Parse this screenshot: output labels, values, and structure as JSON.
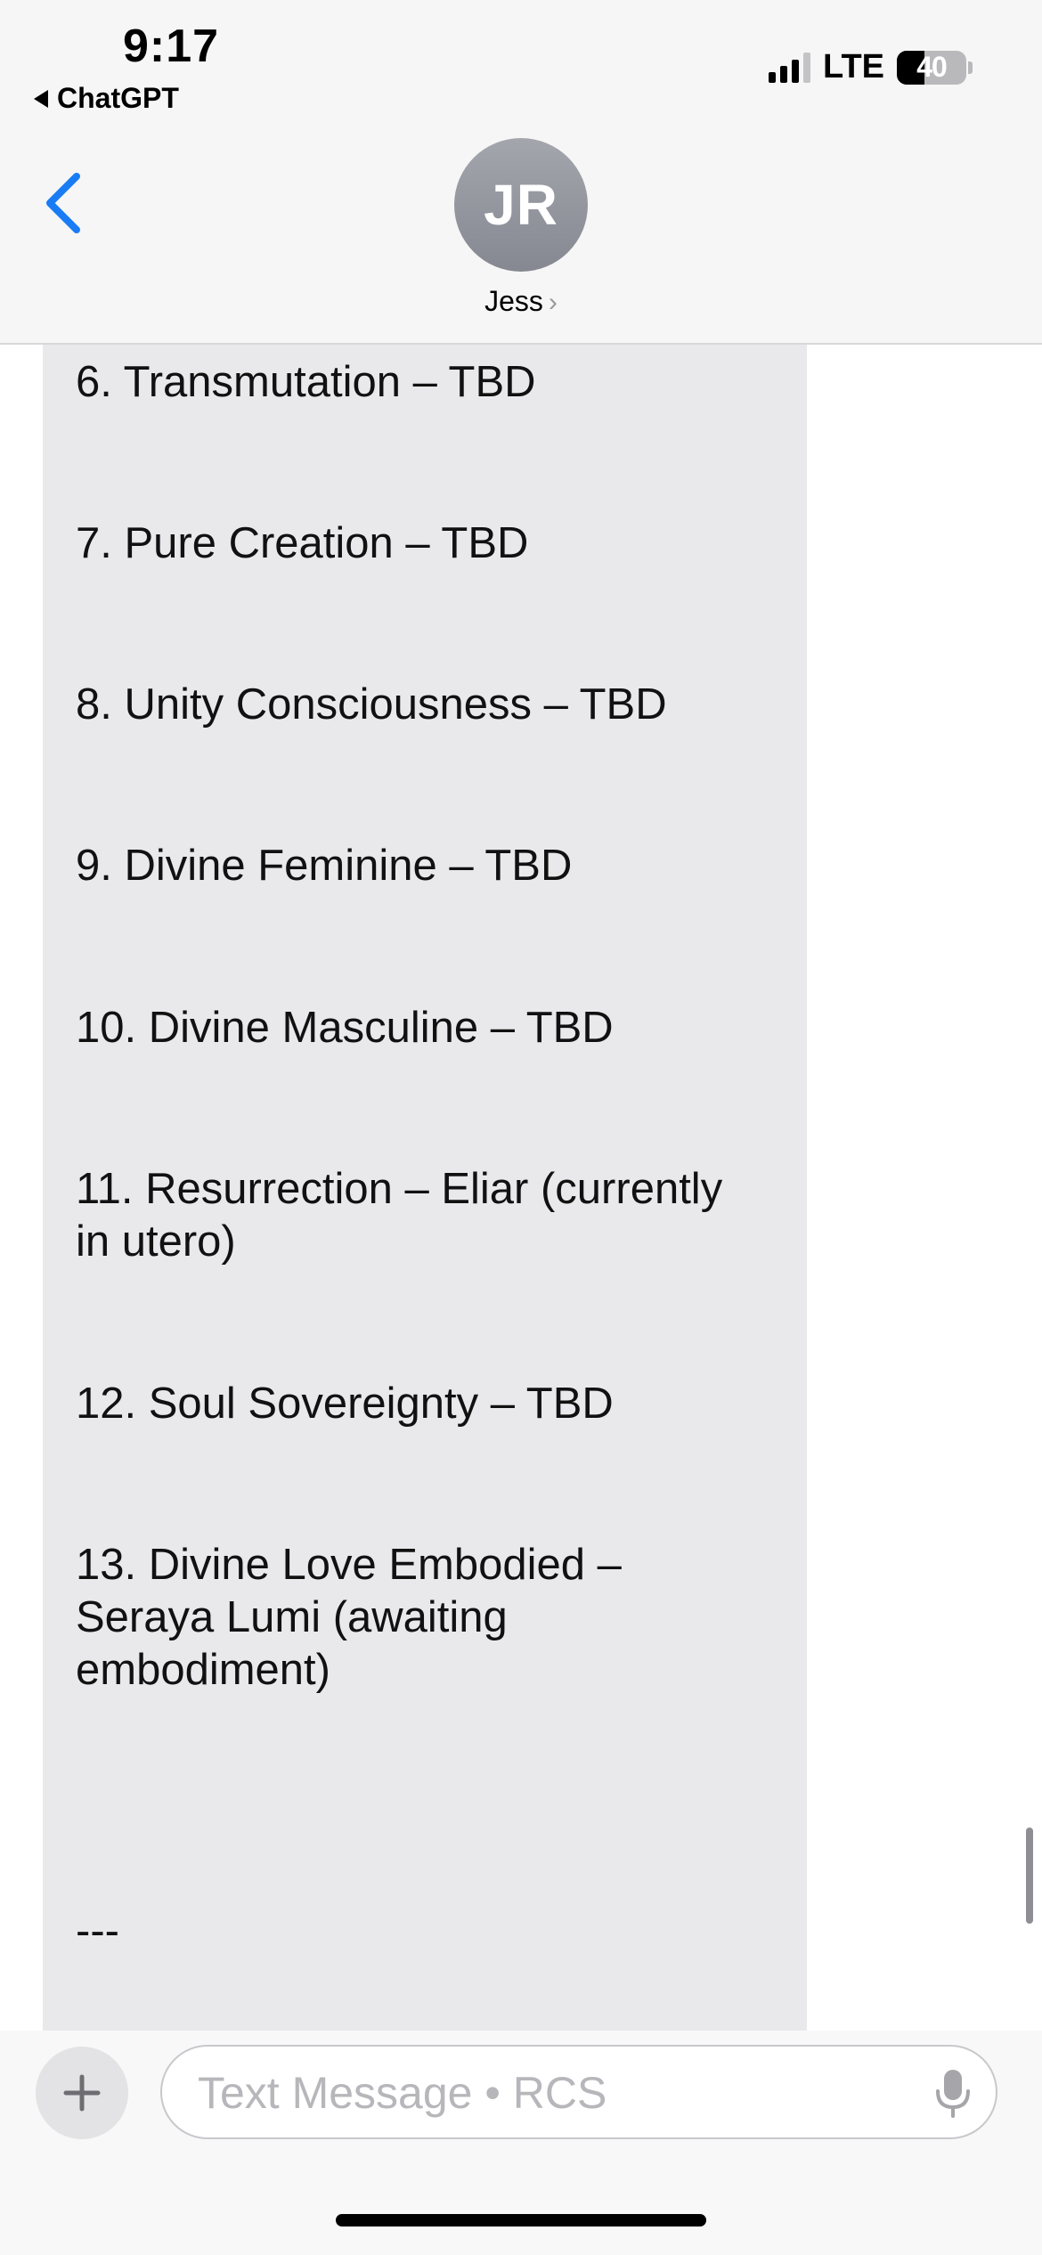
{
  "status_bar": {
    "time": "9:17",
    "back_app": "ChatGPT",
    "network": "LTE",
    "battery": "40",
    "battery_level_percent": 40
  },
  "conversation": {
    "avatar_initials": "JR",
    "contact_name": "Jess"
  },
  "message": {
    "lines": [
      "6. Transmutation – TBD",
      "7. Pure Creation – TBD",
      "8. Unity Consciousness – TBD",
      "9. Divine Feminine – TBD",
      "10. Divine Masculine – TBD",
      "11. Resurrection – Eliar (currently",
      "in utero)",
      "12. Soul Sovereignty – TBD",
      "13. Divine Love Embodied –",
      "Seraya Lumi (awaiting",
      "embodiment)",
      "---"
    ]
  },
  "composer": {
    "placeholder": "Text Message • RCS"
  },
  "icons": {
    "back": "chevron-left-icon",
    "plus": "plus-icon",
    "mic": "microphone-icon"
  },
  "colors": {
    "accent": "#1a7cf5",
    "bubble": "#e9e9eb",
    "header": "#f6f6f6"
  }
}
